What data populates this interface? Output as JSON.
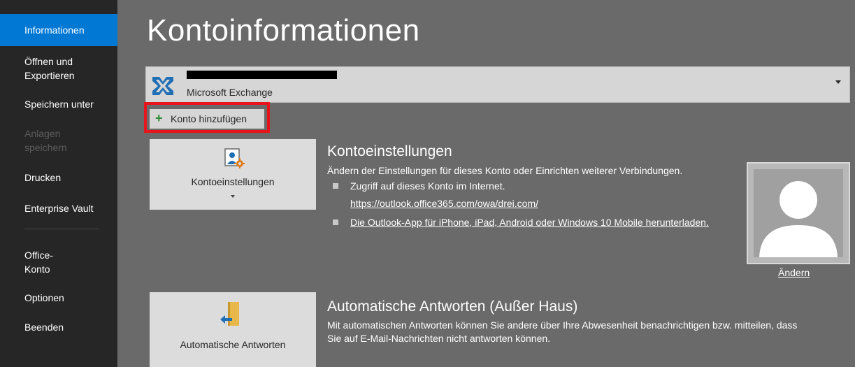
{
  "sidebar": {
    "items": [
      {
        "label": "Informationen",
        "state": "active"
      },
      {
        "label": "Öffnen und",
        "label2": "Exportieren"
      },
      {
        "label": "Speichern unter"
      },
      {
        "label": "Anlagen",
        "label2": "speichern",
        "state": "disabled"
      },
      {
        "label": "Drucken"
      },
      {
        "label": "Enterprise Vault"
      },
      {
        "label": "Office-",
        "label2": "Konto"
      },
      {
        "label": "Optionen"
      },
      {
        "label": "Beenden"
      }
    ]
  },
  "main": {
    "title": "Kontoinformationen",
    "account": {
      "type": "Microsoft Exchange",
      "icon": "exchange-icon"
    },
    "add_account_label": "Konto hinzufügen",
    "account_settings": {
      "tile_label": "Kontoeinstellungen",
      "title": "Kontoeinstellungen",
      "description": "Ändern der Einstellungen für dieses Konto oder Einrichten weiterer Verbindungen.",
      "bullet1": "Zugriff auf dieses Konto im Internet.",
      "bullet1_link": "https://outlook.office365.com/owa/drei.com/",
      "bullet2_link": "Die Outlook-App für iPhone, iPad, Android oder Windows 10 Mobile herunterladen."
    },
    "avatar": {
      "change_label": "Ändern"
    },
    "auto_reply": {
      "tile_label": "Automatische Antworten",
      "title": "Automatische Antworten (Außer Haus)",
      "description_line1": "Mit automatischen Antworten können Sie andere über Ihre Abwesenheit benachrichtigen bzw. mitteilen, dass",
      "description_line2": "Sie auf E-Mail-Nachrichten nicht antworten können."
    }
  },
  "colors": {
    "accent": "#0078d4",
    "sidebar_bg": "#262626",
    "main_bg": "#6a6a6a",
    "highlight": "#e8141c"
  }
}
